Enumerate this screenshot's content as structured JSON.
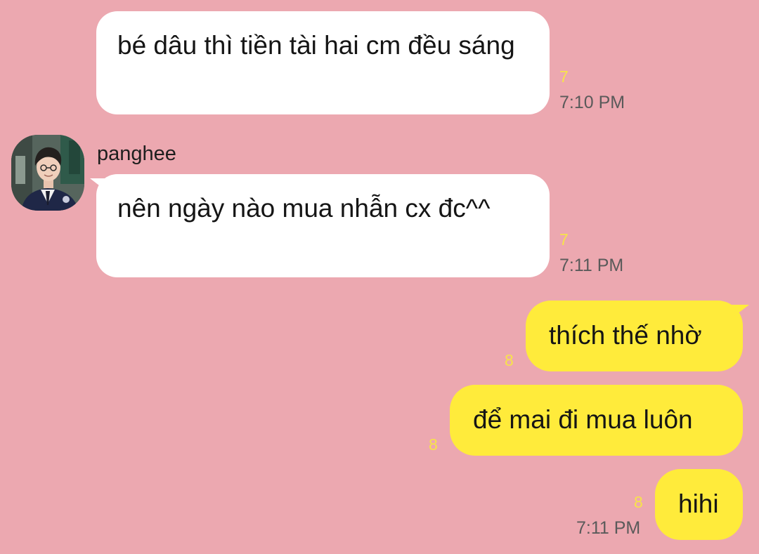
{
  "chat": {
    "background_color": "#eca8b0",
    "incoming_bubble_color": "#ffffff",
    "outgoing_bubble_color": "#ffeb3b",
    "unread_count_color": "#f7e34a",
    "messages": [
      {
        "text": "bé dâu thì tiền tài hai cm đều sáng",
        "unread": "7",
        "time": "7:10 PM"
      },
      {
        "sender": "panghee",
        "avatar": "panghee-avatar",
        "text": "nên ngày nào mua nhẫn cx đc^^",
        "unread": "7",
        "time": "7:11 PM"
      },
      {
        "text": "thích thế nhờ",
        "unread": "8"
      },
      {
        "text": "để mai đi mua luôn",
        "unread": "8"
      },
      {
        "text": "hihi",
        "unread": "8",
        "time": "7:11 PM"
      }
    ]
  }
}
